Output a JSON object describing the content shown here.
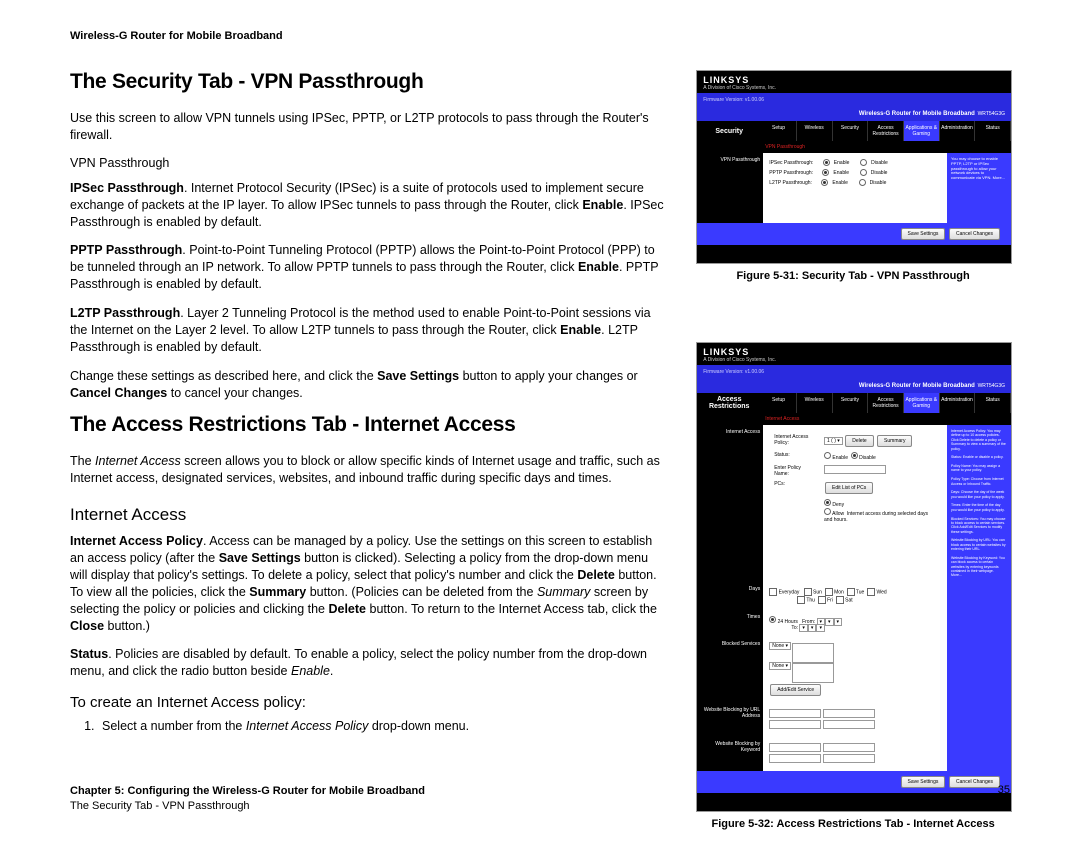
{
  "doc_header": "Wireless-G Router for Mobile Broadband",
  "h1_vpn": "The Security Tab - VPN Passthrough",
  "p_intro": "Use this screen to allow VPN tunnels using IPSec, PPTP, or L2TP protocols to pass through the Router's firewall.",
  "p_vpnlabel": "VPN Passthrough",
  "ipsec_b": "IPSec Passthrough",
  "ipsec_1": ". Internet Protocol Security (IPSec) is a suite of protocols used to implement secure exchange of packets at the IP layer. To allow IPSec tunnels to pass through the Router, click ",
  "ipsec_en": "Enable",
  "ipsec_2": ". IPSec Passthrough is enabled by default.",
  "pptp_b": "PPTP Passthrough",
  "pptp_1": ". Point-to-Point Tunneling Protocol (PPTP) allows the Point-to-Point Protocol (PPP) to be tunneled through an IP network. To allow PPTP tunnels to pass through the Router, click ",
  "pptp_en": "Enable",
  "pptp_2": ". PPTP Passthrough is enabled by default.",
  "l2tp_b": "L2TP Passthrough",
  "l2tp_1": ". Layer 2 Tunneling Protocol is the method used to enable Point-to-Point sessions via the Internet on the Layer 2 level. To allow L2TP tunnels to pass through the Router, click ",
  "l2tp_en": "Enable",
  "l2tp_2": ". L2TP Passthrough is enabled by default.",
  "change_1": "Change these settings as described here, and click the ",
  "save_b": "Save Settings",
  "change_2": " button to apply your changes or ",
  "cancel_b": "Cancel Changes",
  "change_3": " to cancel your changes.",
  "h1_access": "The Access Restrictions Tab - Internet Access",
  "access_intro_1": "The ",
  "access_intro_i": "Internet Access",
  "access_intro_2": " screen allows you to block or allow specific kinds of Internet usage and traffic, such as Internet access, designated services, websites, and inbound traffic during specific days and times.",
  "h2_internet": "Internet Access",
  "iap_b": "Internet Access Policy",
  "iap_1": ". Access can be managed by a policy. Use the settings on this screen to establish an access policy (after the ",
  "iap_save_b": "Save Settings",
  "iap_2": " button is clicked). Selecting a policy from the drop-down menu will display that policy's settings. To delete a policy, select that policy's number and click the ",
  "iap_del_b": "Delete",
  "iap_3": " button. To view all the policies, click the ",
  "iap_sum_b": "Summary",
  "iap_4": " button. (Policies can be deleted from the ",
  "iap_sum_i": "Summary",
  "iap_5": " screen by selecting the policy or policies and clicking the ",
  "iap_del2_b": "Delete",
  "iap_6": " button. To return to the Internet Access tab, click the ",
  "iap_close_b": "Close",
  "iap_7": " button.)",
  "status_b": "Status",
  "status_1": ". Policies are disabled by default. To enable a policy, select the policy number from the drop-down menu, and click the radio button beside ",
  "status_i": "Enable",
  "status_2": ".",
  "h3_create": "To create an Internet Access policy:",
  "step1_a": "Select a number from the ",
  "step1_i": "Internet Access Policy",
  "step1_b": " drop-down menu.",
  "fig31_caption": "Figure 5-31: Security Tab - VPN Passthrough",
  "fig32_caption": "Figure 5-32: Access Restrictions Tab - Internet Access",
  "footer_chapter": "Chapter 5: Configuring the Wireless-G Router for Mobile Broadband",
  "footer_section": "The Security Tab - VPN Passthrough",
  "page_num": "35",
  "ui": {
    "logo": "LINKSYS",
    "sublogo": "A Division of Cisco Systems, Inc.",
    "firmware": "Firmware Version: v1.00.06",
    "product": "Wireless-G Router for Mobile Broadband",
    "model": "WRT54G3G",
    "nav": [
      "Setup",
      "Wireless",
      "Security",
      "Access Restrictions",
      "Applications & Gaming",
      "Administration",
      "Status"
    ],
    "sec_label": "Security",
    "subnav_vpn": "VPN Passthrough",
    "vpn_labels": [
      "IPSec Passthrough:",
      "PPTP Passthrough:",
      "L2TP Passthrough:"
    ],
    "enable": "Enable",
    "disable": "Disable",
    "help_vpn": "You may choose to enable PPTP, L2TP or IPSec passthrough to allow your network devices to communicate via VPN.\nMore...",
    "btn_save": "Save Settings",
    "btn_cancel": "Cancel Changes",
    "ar_label": "Access Restrictions",
    "subnav_ia": "Internet Access",
    "iap_label": "Internet Access Policy:",
    "status_label": "Status:",
    "enter_policy": "Enter Policy Name:",
    "pcs": "PCs:",
    "deny": "Deny",
    "allow": "Allow",
    "days": "Days",
    "everyday": "Everyday",
    "d": [
      "Sun",
      "Mon",
      "Tue",
      "Wed",
      "Thu",
      "Fri",
      "Sat"
    ],
    "times": "Times",
    "h24": "24 Hours",
    "from": "From:",
    "to": "To:",
    "blocked": "Blocked Services",
    "none": "None",
    "addedit": "Add/Edit Service",
    "wburl": "Website Blocking by URL Address",
    "wbkw": "Website Blocking by Keyword",
    "btn_delete": "Delete",
    "btn_summary": "Summary",
    "btn_edit_list": "Edit List of PCs",
    "help_ar": "Internet Access Policy: You may define up to 10 access policies. Click Delete to delete a policy or Summary to view a summary of the policy.\n\nStatus: Enable or disable a policy.\n\nPolicy Name: You may assign a name to your policy.\n\nPolicy Type: Choose from Internet Access or Inbound Traffic.\n\nDays: Choose the day of the week you would like your policy to apply.\n\nTimes: Enter the time of the day you would like your policy to apply.\n\nBlocked Services: You may choose to block access to certain services. Click Add/Edit Services to modify these settings.\n\nWebsite Blocking by URL: You can block access to certain websites by entering their URL.\n\nWebsite Blocking by Keyword: You can block access to certain websites by entering keywords contained in their webpage.\nMore..."
  }
}
